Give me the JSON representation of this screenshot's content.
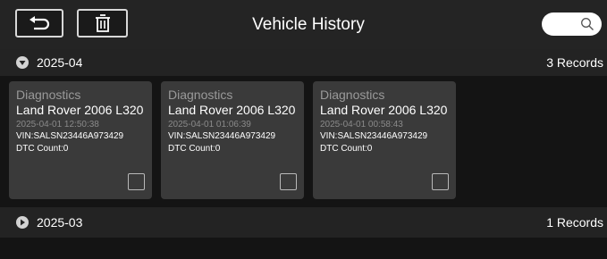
{
  "header": {
    "title": "Vehicle History",
    "back_icon": "back-arrow-icon",
    "delete_icon": "trash-icon",
    "search_icon": "search-icon",
    "search_value": ""
  },
  "groups": [
    {
      "label": "2025-04",
      "count": "3 Records",
      "expanded": true,
      "records": [
        {
          "type": "Diagnostics",
          "vehicle": "Land Rover 2006 L320",
          "datetime": "2025-04-01 12:50:38",
          "vin": "VIN:SALSN23446A973429",
          "dtc": "DTC Count:0",
          "checked": false
        },
        {
          "type": "Diagnostics",
          "vehicle": "Land Rover 2006 L320",
          "datetime": "2025-04-01 01:06:39",
          "vin": "VIN:SALSN23446A973429",
          "dtc": "DTC Count:0",
          "checked": false
        },
        {
          "type": "Diagnostics",
          "vehicle": "Land Rover 2006 L320",
          "datetime": "2025-04-01 00:58:43",
          "vin": "VIN:SALSN23446A973429",
          "dtc": "DTC Count:0",
          "checked": false
        }
      ]
    },
    {
      "label": "2025-03",
      "count": "1 Records",
      "expanded": false,
      "records": []
    }
  ],
  "colors": {
    "background": "#141414",
    "topbar": "#242424",
    "group_header": "#232323",
    "card": "#3a3a3a",
    "muted_text": "#9a9a9a"
  }
}
